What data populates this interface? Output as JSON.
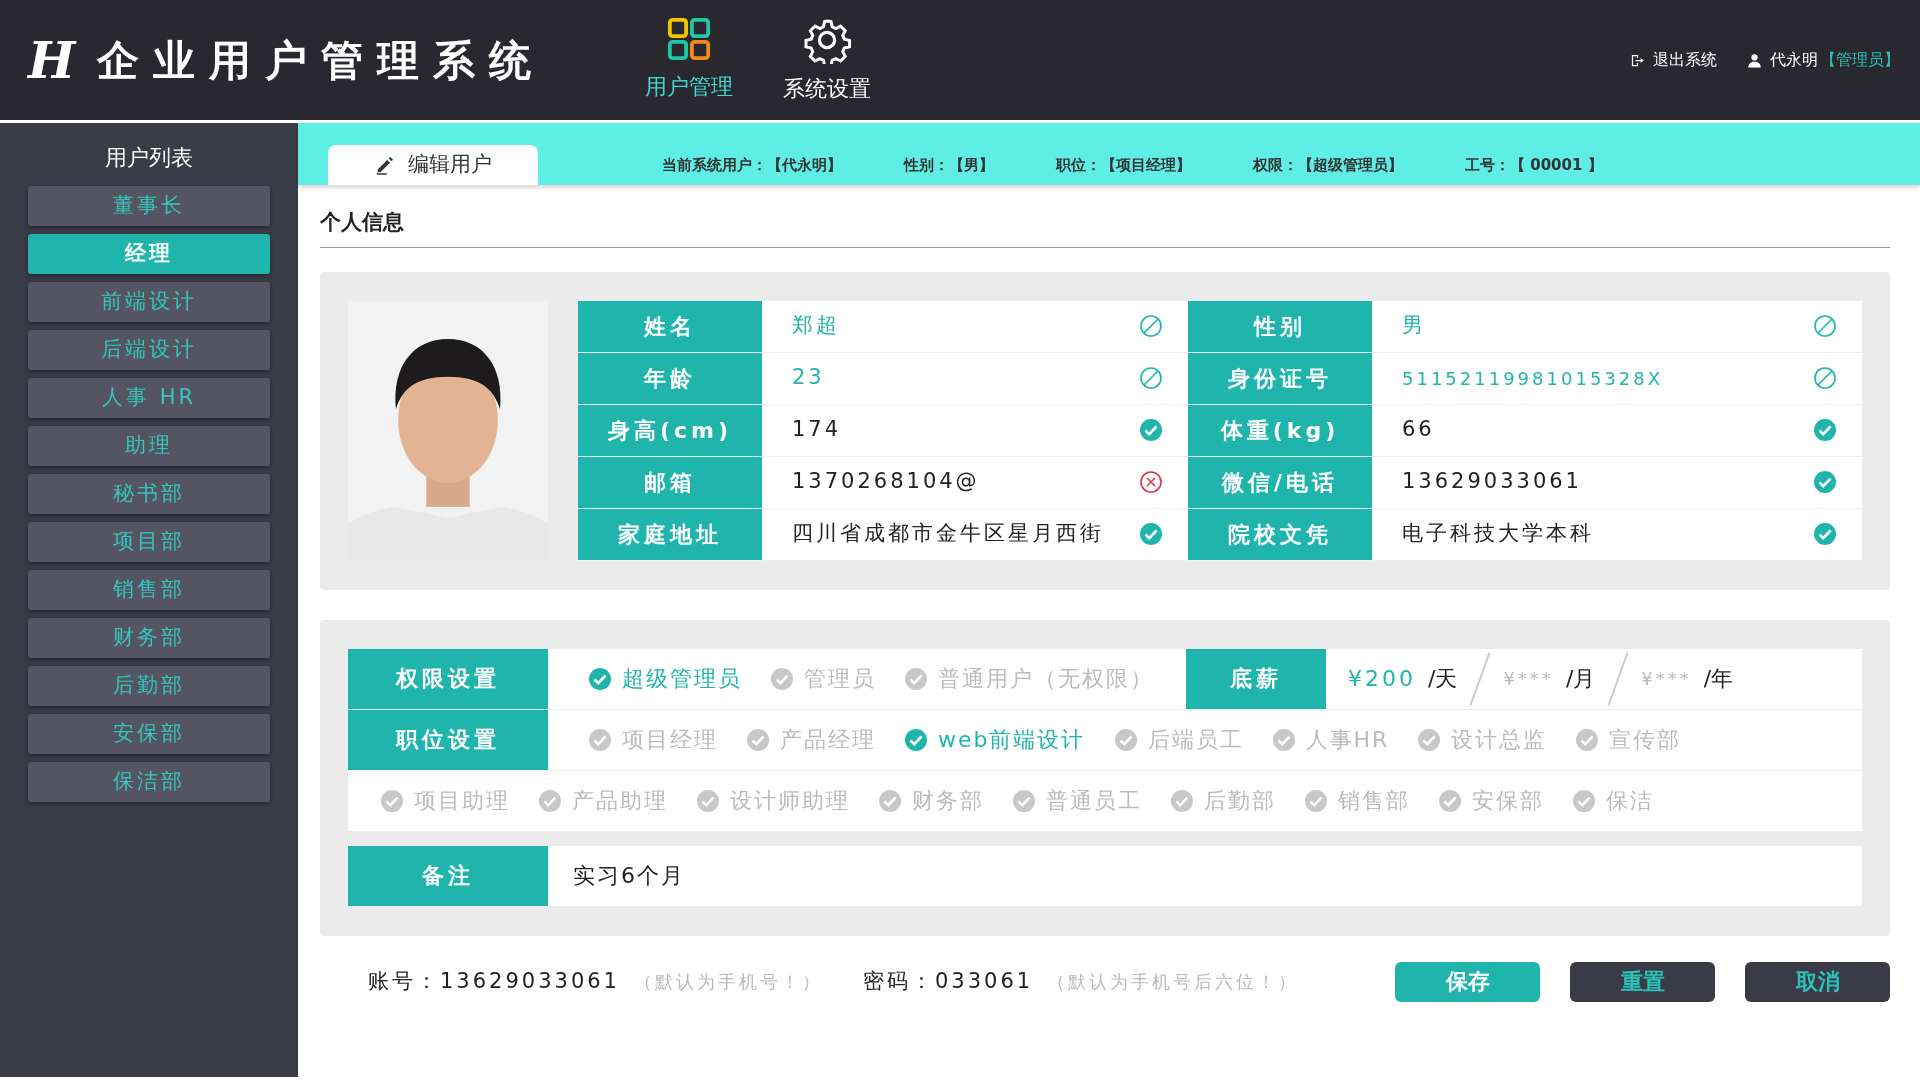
{
  "header": {
    "logo": "H",
    "title": "企业用户管理系统",
    "nav": [
      {
        "label": "用户管理",
        "selected": true
      },
      {
        "label": "系统设置",
        "selected": false
      }
    ],
    "logout": "退出系统",
    "user": "代永明",
    "role": "【管理员】"
  },
  "sidebar": {
    "title": "用户列表",
    "items": [
      {
        "label": "董事长",
        "selected": false
      },
      {
        "label": "经理",
        "selected": true
      },
      {
        "label": "前端设计",
        "selected": false
      },
      {
        "label": "后端设计",
        "selected": false
      },
      {
        "label": "人事 HR",
        "selected": false
      },
      {
        "label": "助理",
        "selected": false
      },
      {
        "label": "秘书部",
        "selected": false
      },
      {
        "label": "项目部",
        "selected": false
      },
      {
        "label": "销售部",
        "selected": false
      },
      {
        "label": "财务部",
        "selected": false
      },
      {
        "label": "后勤部",
        "selected": false
      },
      {
        "label": "安保部",
        "selected": false
      },
      {
        "label": "保洁部",
        "selected": false
      }
    ]
  },
  "toolbar": {
    "tab": "编辑用户",
    "info": [
      "当前系统用户：【代永明】",
      "性别：【男】",
      "职位：【项目经理】",
      "权限：【超级管理员】",
      "工号：【 00001 】"
    ]
  },
  "section_title": "个人信息",
  "profile": {
    "fields": [
      {
        "label": "姓名",
        "value": "郑超",
        "kind": "locked"
      },
      {
        "label": "性别",
        "value": "男",
        "kind": "locked"
      },
      {
        "label": "年龄",
        "value": "23",
        "kind": "locked"
      },
      {
        "label": "身份证号",
        "value": "51152119981015328X",
        "kind": "locked"
      },
      {
        "label": "身高(cm)",
        "value": "174",
        "kind": "valid"
      },
      {
        "label": "体重(kg)",
        "value": "66",
        "kind": "valid"
      },
      {
        "label": "邮箱",
        "value": "1370268104@",
        "kind": "invalid"
      },
      {
        "label": "微信/电话",
        "value": "13629033061",
        "kind": "valid"
      },
      {
        "label": "家庭地址",
        "value": "四川省成都市金牛区星月西街",
        "kind": "valid"
      },
      {
        "label": "院校文凭",
        "value": "电子科技大学本科",
        "kind": "valid"
      }
    ]
  },
  "permission": {
    "label": "权限设置",
    "options": [
      {
        "label": "超级管理员",
        "selected": true
      },
      {
        "label": "管理员",
        "selected": false
      },
      {
        "label": "普通用户（无权限）",
        "selected": false
      }
    ]
  },
  "salary": {
    "label": "底薪",
    "amounts": [
      {
        "value": "¥200",
        "unit": "/天",
        "disabled": false
      },
      {
        "value": "¥***",
        "unit": "/月",
        "disabled": true
      },
      {
        "value": "¥***",
        "unit": "/年",
        "disabled": true
      }
    ]
  },
  "position": {
    "label": "职位设置",
    "option_rows": [
      [
        {
          "label": "项目经理",
          "selected": false
        },
        {
          "label": "产品经理",
          "selected": false
        },
        {
          "label": "web前端设计",
          "selected": true
        },
        {
          "label": "后端员工",
          "selected": false
        },
        {
          "label": "人事HR",
          "selected": false
        },
        {
          "label": "设计总监",
          "selected": false
        },
        {
          "label": "宣传部",
          "selected": false
        }
      ],
      [
        {
          "label": "项目助理",
          "selected": false
        },
        {
          "label": "产品助理",
          "selected": false
        },
        {
          "label": "设计师助理",
          "selected": false
        },
        {
          "label": "财务部",
          "selected": false
        },
        {
          "label": "普通员工",
          "selected": false
        },
        {
          "label": "后勤部",
          "selected": false
        },
        {
          "label": "销售部",
          "selected": false
        },
        {
          "label": "安保部",
          "selected": false
        },
        {
          "label": "保洁",
          "selected": false
        }
      ]
    ]
  },
  "remark": {
    "label": "备注",
    "value": "实习6个月"
  },
  "footer": {
    "credentials": [
      {
        "label": "账号：",
        "value": "13629033061",
        "hint": "（默认为手机号！）"
      },
      {
        "label": "密码：",
        "value": "033061",
        "hint": "（默认为手机号后六位！）"
      }
    ],
    "buttons": [
      {
        "label": "保存",
        "kind": "primary"
      },
      {
        "label": "重置",
        "kind": "secondary"
      },
      {
        "label": "取消",
        "kind": "secondary"
      }
    ]
  }
}
